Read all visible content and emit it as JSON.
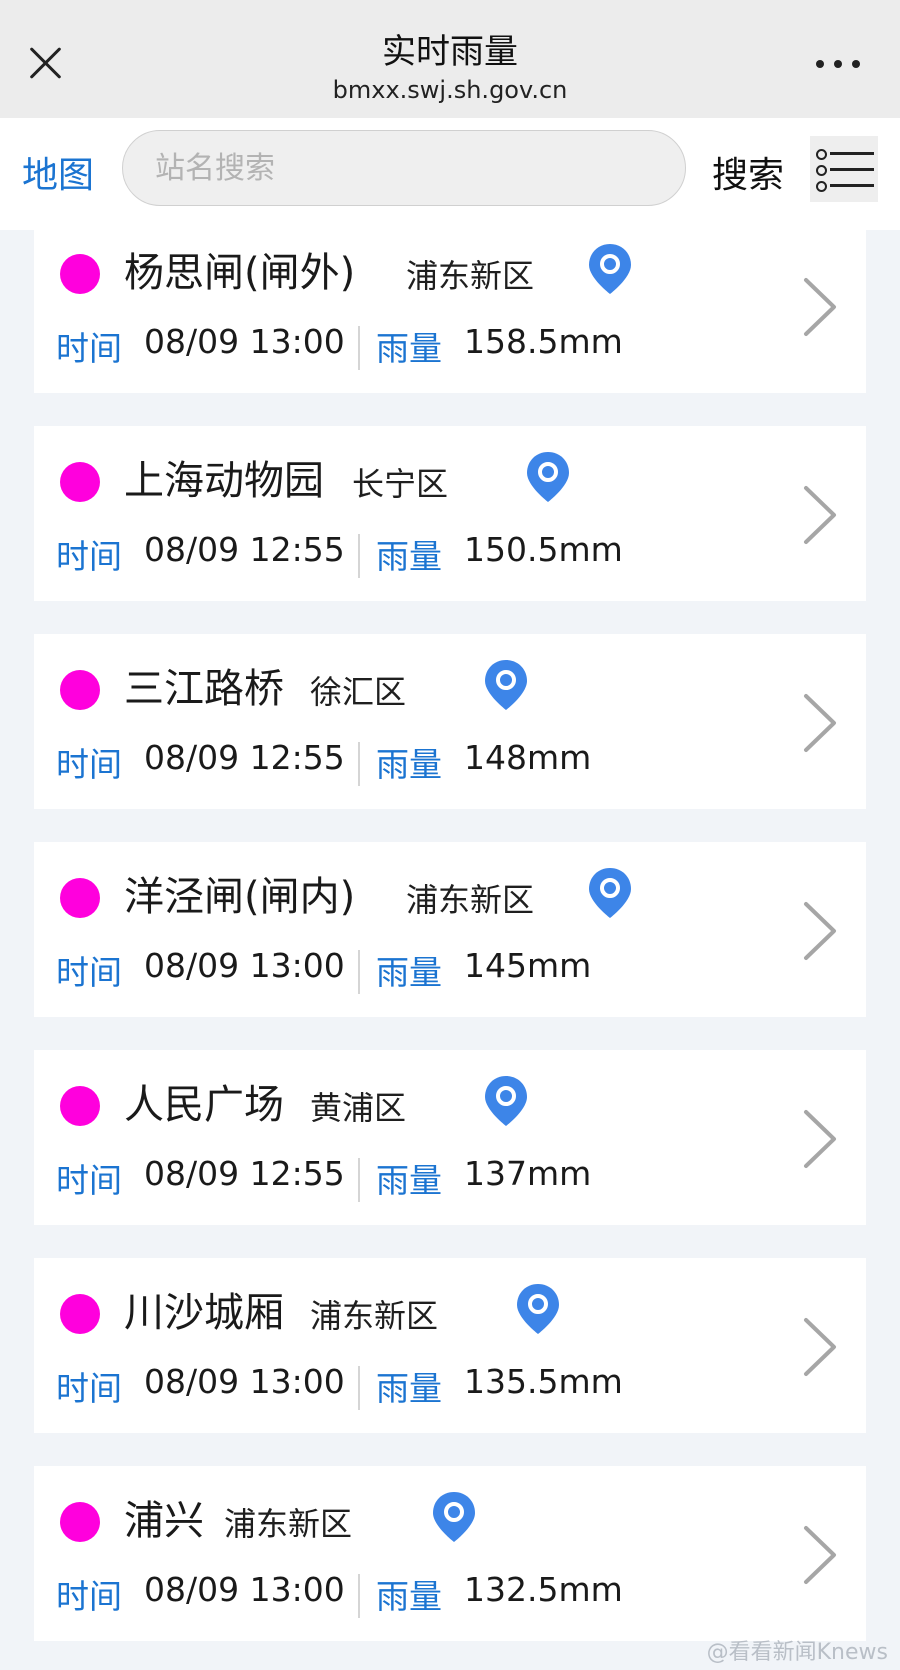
{
  "header": {
    "title": "实时雨量",
    "url": "bmxx.swj.sh.gov.cn"
  },
  "toolbar": {
    "map_label": "地图",
    "search_placeholder": "站名搜索",
    "search_label": "搜索"
  },
  "labels": {
    "time": "时间",
    "rainfall": "雨量"
  },
  "colors": {
    "accent": "#1b74d1",
    "status_dot": "#ff00dd",
    "pin": "#3d85e8"
  },
  "stations": [
    {
      "name": "杨思闸(闸外)",
      "district": "浦东新区",
      "time": "08/09 13:00",
      "rainfall": "158.5mm"
    },
    {
      "name": "上海动物园",
      "district": "长宁区",
      "time": "08/09 12:55",
      "rainfall": "150.5mm"
    },
    {
      "name": "三江路桥",
      "district": "徐汇区",
      "time": "08/09 12:55",
      "rainfall": "148mm"
    },
    {
      "name": "洋泾闸(闸内)",
      "district": "浦东新区",
      "time": "08/09 13:00",
      "rainfall": "145mm"
    },
    {
      "name": "人民广场",
      "district": "黄浦区",
      "time": "08/09 12:55",
      "rainfall": "137mm"
    },
    {
      "name": "川沙城厢",
      "district": "浦东新区",
      "time": "08/09 13:00",
      "rainfall": "135.5mm"
    },
    {
      "name": "浦兴",
      "district": "浦东新区",
      "time": "08/09 13:00",
      "rainfall": "132.5mm"
    }
  ],
  "watermark": "@看看新闻Knews"
}
